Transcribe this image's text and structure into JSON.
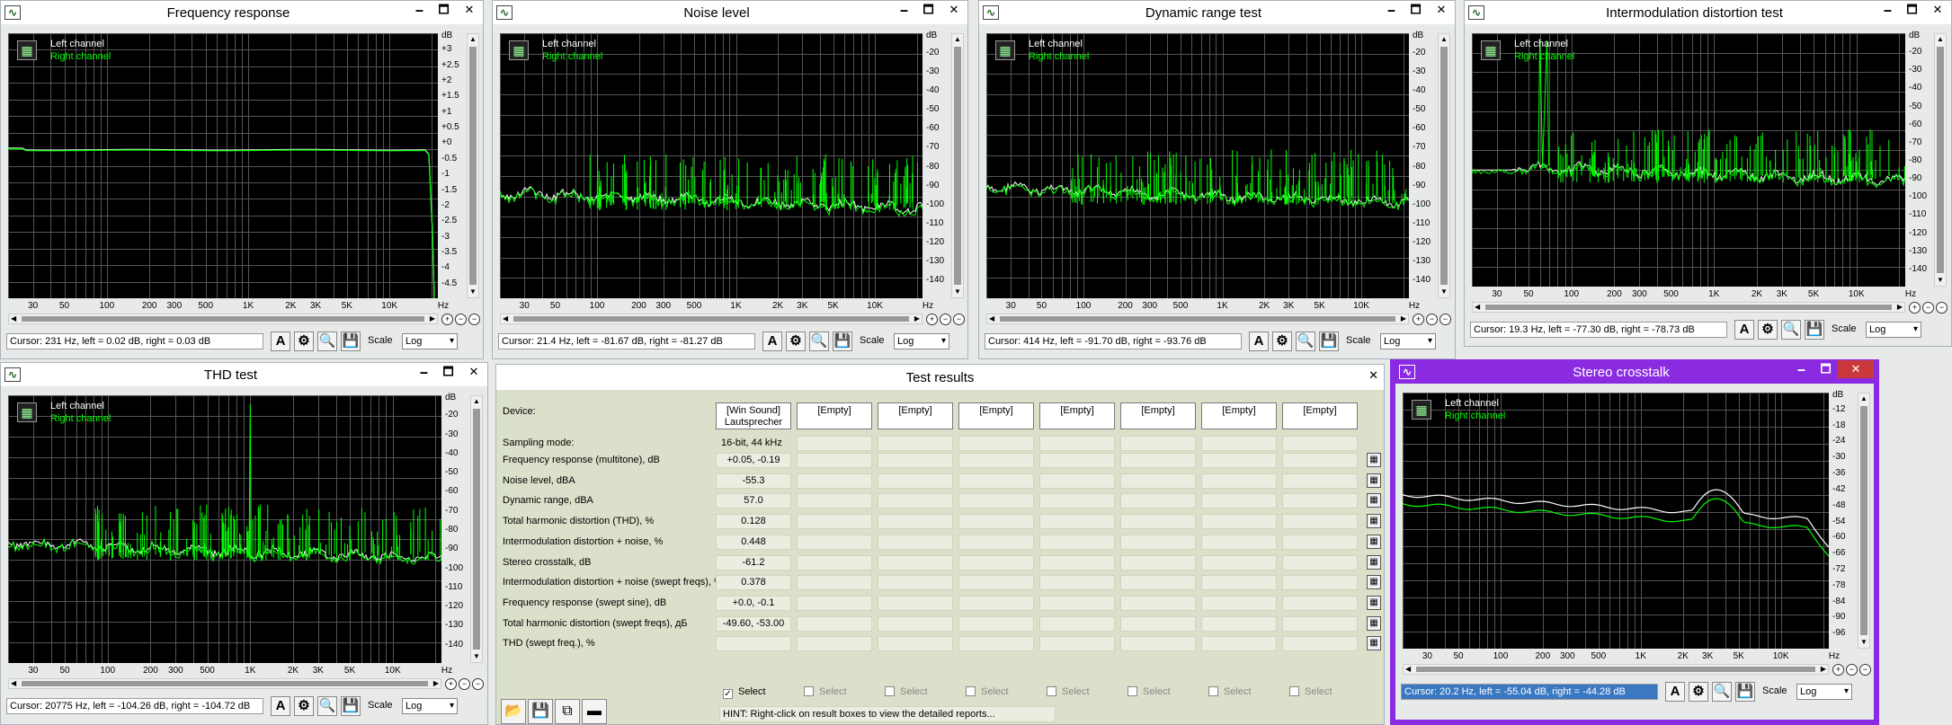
{
  "colors": {
    "plot_bg": "#000000",
    "left": "#ffffff",
    "right": "#00ff00",
    "grid": "#555555",
    "accent": "#8a2be2"
  },
  "icons": {
    "app": "spectrum-app-icon",
    "graph": "graph-icon",
    "font": "font-icon",
    "gear": "gear-icon",
    "zoom": "zoom-icon",
    "save": "save-icon",
    "folder": "folder-icon",
    "copy": "copy-icon",
    "minus": "minus-icon",
    "table": "table-icon"
  },
  "ctl": {
    "min": "🗕",
    "max": "🗖",
    "close": "✕"
  },
  "legend": {
    "left": "Left channel",
    "right": "Right channel"
  },
  "scale_label": "Scale",
  "scale_value": "Log",
  "zoom_glyphs": [
    "+",
    "−",
    "−"
  ],
  "tool_glyphs": [
    "A",
    "⚙",
    "🔍",
    "💾"
  ],
  "windows": [
    {
      "title": "Frequency response",
      "unit": "dB",
      "yticks": [
        "+3",
        "+2.5",
        "+2",
        "+1.5",
        "+1",
        "+0.5",
        "+0",
        "-0.5",
        "-1",
        "-1.5",
        "-2",
        "-2.5",
        "-3",
        "-3.5",
        "-4",
        "-4.5"
      ],
      "xticks": [
        "30",
        "50",
        "100",
        "200",
        "300",
        "500",
        "1K",
        "2K",
        "3K",
        "5K",
        "10K",
        "Hz"
      ],
      "cursor": "Cursor:  231 Hz,  left = 0.02 dB,  right = 0.03 dB"
    },
    {
      "title": "Noise level",
      "unit": "dB",
      "yticks": [
        "-20",
        "-30",
        "-40",
        "-50",
        "-60",
        "-70",
        "-80",
        "-90",
        "-100",
        "-110",
        "-120",
        "-130",
        "-140"
      ],
      "xticks": [
        "30",
        "50",
        "100",
        "200",
        "300",
        "500",
        "1K",
        "2K",
        "3K",
        "5K",
        "10K",
        "Hz"
      ],
      "cursor": "Cursor:  21.4 Hz,  left = -81.67 dB,  right = -81.27 dB"
    },
    {
      "title": "Dynamic range test",
      "unit": "dB",
      "yticks": [
        "-20",
        "-30",
        "-40",
        "-50",
        "-60",
        "-70",
        "-80",
        "-90",
        "-100",
        "-110",
        "-120",
        "-130",
        "-140"
      ],
      "xticks": [
        "30",
        "50",
        "100",
        "200",
        "300",
        "500",
        "1K",
        "2K",
        "3K",
        "5K",
        "10K",
        "Hz"
      ],
      "cursor": "Cursor:  414 Hz,  left = -91.70 dB,  right = -93.76 dB"
    },
    {
      "title": "Intermodulation distortion test",
      "unit": "dB",
      "yticks": [
        "-20",
        "-30",
        "-40",
        "-50",
        "-60",
        "-70",
        "-80",
        "-90",
        "-100",
        "-110",
        "-120",
        "-130",
        "-140"
      ],
      "xticks": [
        "30",
        "50",
        "100",
        "200",
        "300",
        "500",
        "1K",
        "2K",
        "3K",
        "5K",
        "10K",
        "Hz"
      ],
      "cursor": "Cursor:  19.3 Hz,  left = -77.30 dB,  right = -78.73 dB"
    },
    {
      "title": "THD test",
      "unit": "dB",
      "yticks": [
        "-20",
        "-30",
        "-40",
        "-50",
        "-60",
        "-70",
        "-80",
        "-90",
        "-100",
        "-110",
        "-120",
        "-130",
        "-140"
      ],
      "xticks": [
        "30",
        "50",
        "100",
        "200",
        "300",
        "500",
        "1K",
        "2K",
        "3K",
        "5K",
        "10K",
        "Hz"
      ],
      "cursor": "Cursor:  20775 Hz,  left = -104.26 dB,  right = -104.72 dB"
    },
    {
      "title": "Stereo crosstalk",
      "unit": "dB",
      "yticks": [
        "-12",
        "-18",
        "-24",
        "-30",
        "-36",
        "-42",
        "-48",
        "-54",
        "-60",
        "-66",
        "-72",
        "-78",
        "-84",
        "-90",
        "-96"
      ],
      "xticks": [
        "30",
        "50",
        "100",
        "200",
        "300",
        "500",
        "1K",
        "2K",
        "3K",
        "5K",
        "10K",
        "Hz"
      ],
      "cursor": "Cursor:  20.2 Hz,  left = -55.04 dB,  right = -44.28 dB"
    }
  ],
  "results": {
    "title": "Test results",
    "close": "✕",
    "device_label": "Device:",
    "devices": [
      "[Win Sound]\nLautsprecher",
      "[Empty]",
      "[Empty]",
      "[Empty]",
      "[Empty]",
      "[Empty]",
      "[Empty]",
      "[Empty]"
    ],
    "sampling_label": "Sampling mode:",
    "sampling_value": "16-bit, 44 kHz",
    "rows": [
      {
        "label": "Frequency response (multitone), dB",
        "value": "+0.05, -0.19"
      },
      {
        "label": "Noise level, dBA",
        "value": "-55.3"
      },
      {
        "label": "Dynamic range, dBA",
        "value": "57.0"
      },
      {
        "label": "Total harmonic distortion (THD), %",
        "value": "0.128"
      },
      {
        "label": "Intermodulation distortion + noise, %",
        "value": "0.448"
      },
      {
        "label": "Stereo crosstalk, dB",
        "value": "-61.2"
      },
      {
        "label": "Intermodulation distortion + noise (swept freqs), %",
        "value": "0.378"
      },
      {
        "label": "Frequency response (swept sine), dB",
        "value": "+0.0, -0.1"
      },
      {
        "label": "Total harmonic distortion (swept freqs), дБ",
        "value": "-49.60, -53.00"
      },
      {
        "label": "THD (swept freq.), %",
        "value": ""
      }
    ],
    "select_label": "Select",
    "hint": "HINT: Right-click on result boxes to view the detailed reports..."
  }
}
